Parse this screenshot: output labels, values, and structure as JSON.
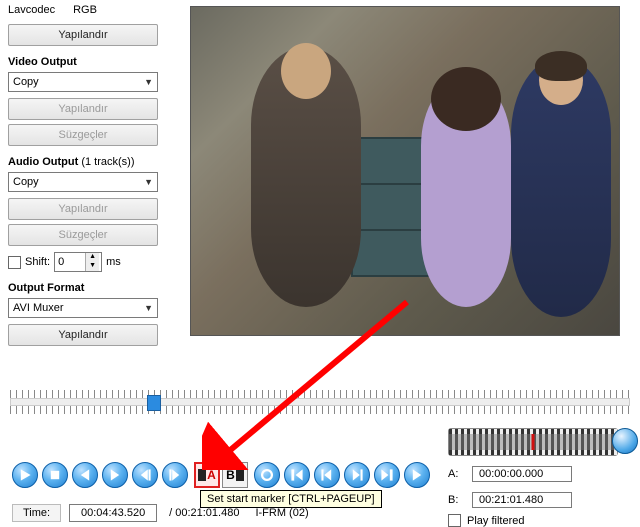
{
  "header": {
    "decoder": "Lavcodec",
    "colorspace": "RGB",
    "configure": "Yapılandır"
  },
  "video_output": {
    "title": "Video Output",
    "codec": "Copy",
    "configure": "Yapılandır",
    "filters": "Süzgeçler"
  },
  "audio_output": {
    "title": "Audio Output",
    "tracks_suffix": "(1 track(s))",
    "codec": "Copy",
    "configure": "Yapılandır",
    "filters": "Süzgeçler",
    "shift_label": "Shift:",
    "shift_value": "0",
    "shift_unit": "ms"
  },
  "output_format": {
    "title": "Output Format",
    "muxer": "AVI Muxer",
    "configure": "Yapılandır"
  },
  "timeline": {
    "thumb_percent": 22
  },
  "transport": {
    "marker_a_label": "A",
    "marker_b_label": "B",
    "tooltip": "Set start marker [CTRL+PAGEUP]"
  },
  "time": {
    "label": "Time:",
    "current": "00:04:43.520",
    "total": "/ 00:21:01.480",
    "frame": "I-FRM (02)"
  },
  "markers": {
    "a_label": "A:",
    "a_value": "00:00:00.000",
    "b_label": "B:",
    "b_value": "00:21:01.480",
    "play_filtered": "Play filtered"
  }
}
